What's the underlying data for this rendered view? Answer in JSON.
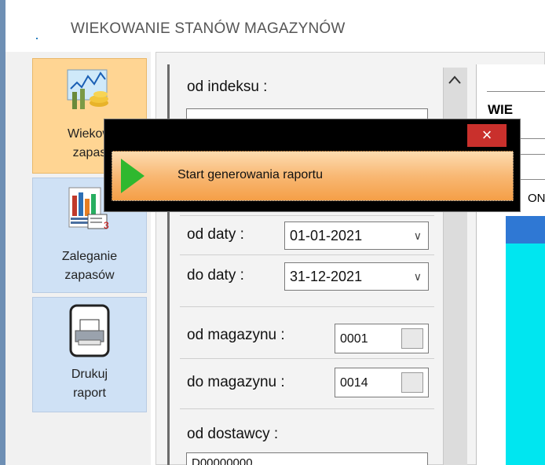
{
  "window": {
    "title": "WIEKOWANIE STANÓW MAGAZYNÓW"
  },
  "sidebar": {
    "items": [
      {
        "line1": "Wiekow",
        "line2": "zapas",
        "icon": "aging-chart-icon",
        "active": true
      },
      {
        "line1": "Zaleganie",
        "line2": "zapasów",
        "icon": "stock-chart-icon",
        "active": false
      },
      {
        "line1": "Drukuj",
        "line2": "raport",
        "icon": "printer-icon",
        "active": false
      }
    ]
  },
  "form": {
    "od_indeksu_label": "od indeksu :",
    "od_daty_label": "od daty :",
    "od_daty_value": "01-01-2021",
    "do_daty_label": "do daty :",
    "do_daty_value": "31-12-2021",
    "od_magazynu_label": "od magazynu :",
    "od_magazynu_value": "0001",
    "do_magazynu_label": "do magazynu :",
    "do_magazynu_value": "0014",
    "od_dostawcy_label": "od dostawcy :",
    "od_dostawcy_value": "D00000000"
  },
  "report_preview": {
    "heading_fragment": "WIE",
    "column_fragment": "ONI"
  },
  "popup": {
    "close_label": "×",
    "item_label": "Start generowania raportu"
  },
  "colors": {
    "accent_active": "#ffd593",
    "sidebar_button": "#cfe1f5",
    "cyan_grid": "#00e6f0",
    "close_red": "#c9302c"
  }
}
